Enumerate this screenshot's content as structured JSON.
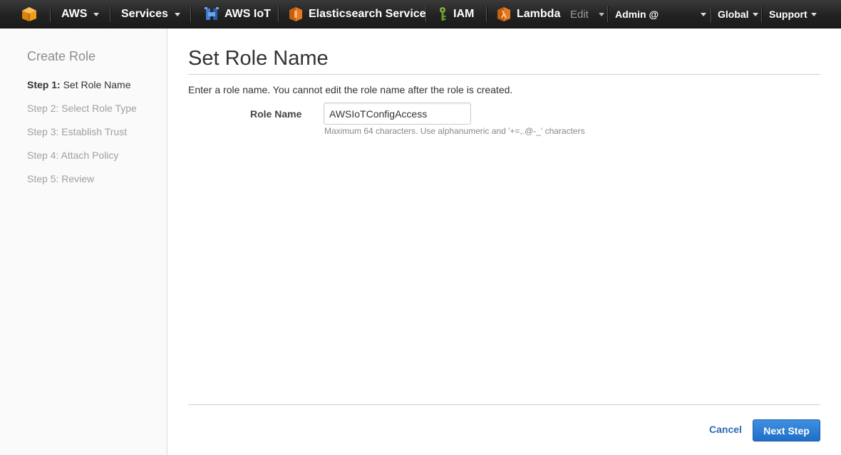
{
  "nav": {
    "aws_label": "AWS",
    "services_label": "Services",
    "iot_label": "AWS IoT",
    "es_label": "Elasticsearch Service",
    "iam_label": "IAM",
    "lambda_label": "Lambda",
    "edit_label": "Edit",
    "account_label": "Admin @",
    "region_label": "Global",
    "support_label": "Support",
    "colors": {
      "bar": "#232323",
      "orange": "#f09b1a",
      "iot_blue": "#3f7fd6",
      "iam_green": "#7fb338"
    }
  },
  "sidebar": {
    "title": "Create Role",
    "steps": [
      {
        "prefix": "Step 1:",
        "label": "Set Role Name",
        "active": true
      },
      {
        "prefix": "Step 2:",
        "label": "Select Role Type",
        "active": false
      },
      {
        "prefix": "Step 3:",
        "label": "Establish Trust",
        "active": false
      },
      {
        "prefix": "Step 4:",
        "label": "Attach Policy",
        "active": false
      },
      {
        "prefix": "Step 5:",
        "label": "Review",
        "active": false
      }
    ]
  },
  "main": {
    "title": "Set Role Name",
    "instructions": "Enter a role name. You cannot edit the role name after the role is created.",
    "role_name_label": "Role Name",
    "role_name_value": "AWSIoTConfigAccess",
    "role_name_hint": "Maximum 64 characters. Use alphanumeric and '+=,.@-_' characters"
  },
  "footer": {
    "cancel_label": "Cancel",
    "next_label": "Next Step",
    "colors": {
      "link": "#2a6bb4",
      "button": "#2a7ad4"
    }
  }
}
